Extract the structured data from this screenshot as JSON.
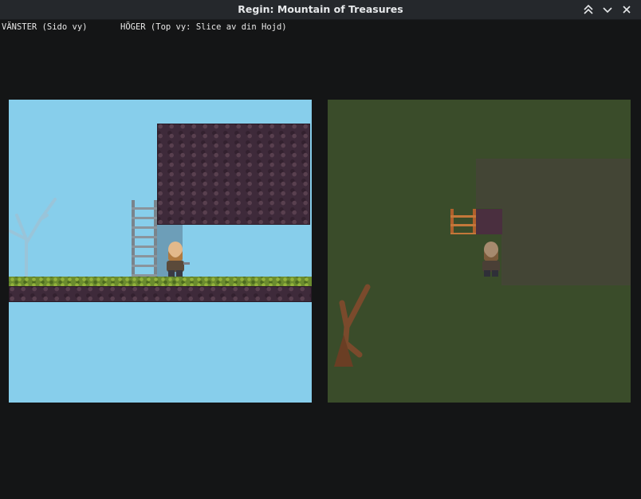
{
  "window": {
    "title": "Regin: Mountain of Treasures",
    "controls": [
      "chevrons-up-icon",
      "chevron-down-icon",
      "close-icon"
    ]
  },
  "hud": {
    "left_label": "VÄNSTER (Sido vy)",
    "right_label": "HÖGER (Top vy: Slice av din Hojd)"
  },
  "side_view": {
    "sky_color": "#87ceeb",
    "rock_color": "#3e2a3a",
    "grass_color": "#6b8c2e"
  },
  "top_view": {
    "grass_color": "#7fa92c"
  }
}
